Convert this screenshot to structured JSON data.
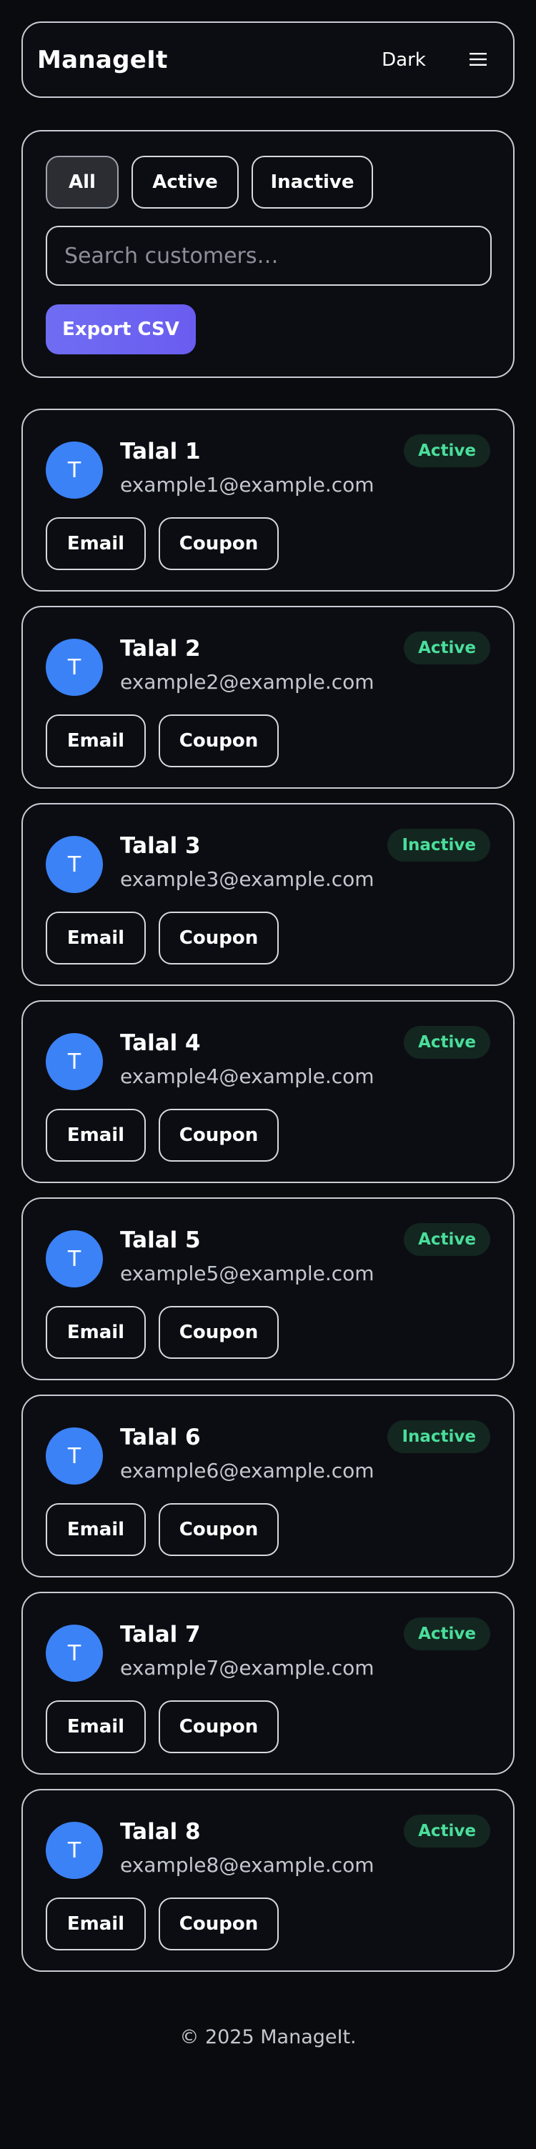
{
  "header": {
    "brand": "ManageIt",
    "theme_label": "Dark",
    "menu_icon": "hamburger-menu-icon"
  },
  "filters": {
    "tabs": [
      {
        "label": "All",
        "active": true
      },
      {
        "label": "Active",
        "active": false
      },
      {
        "label": "Inactive",
        "active": false
      }
    ],
    "search": {
      "placeholder": "Search customers…",
      "value": ""
    },
    "export_label": "Export CSV"
  },
  "colors": {
    "accent": "#6f6df2",
    "avatar": "#3b82f6",
    "status_text": "#4ade9b",
    "status_bg": "#132620",
    "background": "#0a0b0e"
  },
  "customers": [
    {
      "initial": "T",
      "name": "Talal 1",
      "email": "example1@example.com",
      "status": "Active",
      "email_label": "Email",
      "coupon_label": "Coupon"
    },
    {
      "initial": "T",
      "name": "Talal 2",
      "email": "example2@example.com",
      "status": "Active",
      "email_label": "Email",
      "coupon_label": "Coupon"
    },
    {
      "initial": "T",
      "name": "Talal 3",
      "email": "example3@example.com",
      "status": "Inactive",
      "email_label": "Email",
      "coupon_label": "Coupon"
    },
    {
      "initial": "T",
      "name": "Talal 4",
      "email": "example4@example.com",
      "status": "Active",
      "email_label": "Email",
      "coupon_label": "Coupon"
    },
    {
      "initial": "T",
      "name": "Talal 5",
      "email": "example5@example.com",
      "status": "Active",
      "email_label": "Email",
      "coupon_label": "Coupon"
    },
    {
      "initial": "T",
      "name": "Talal 6",
      "email": "example6@example.com",
      "status": "Inactive",
      "email_label": "Email",
      "coupon_label": "Coupon"
    },
    {
      "initial": "T",
      "name": "Talal 7",
      "email": "example7@example.com",
      "status": "Active",
      "email_label": "Email",
      "coupon_label": "Coupon"
    },
    {
      "initial": "T",
      "name": "Talal 8",
      "email": "example8@example.com",
      "status": "Active",
      "email_label": "Email",
      "coupon_label": "Coupon"
    }
  ],
  "footer": {
    "text": "© 2025 ManageIt."
  }
}
